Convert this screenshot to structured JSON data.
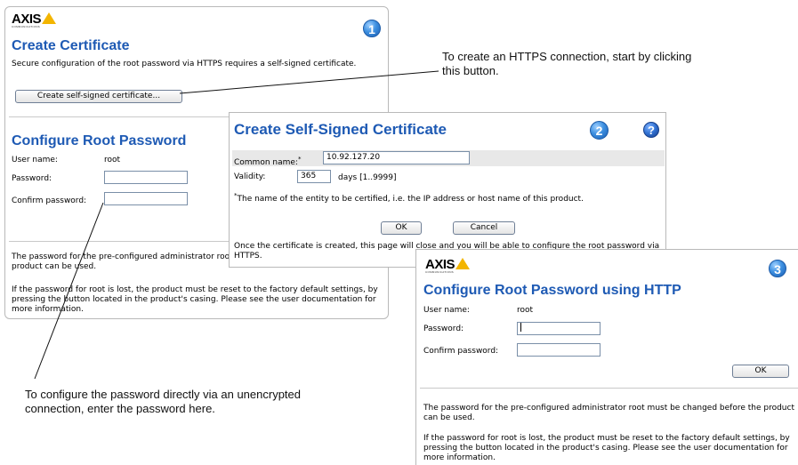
{
  "panel1": {
    "logo": "AXIS",
    "logo_sub": "COMMUNICATIONS",
    "badge": "1",
    "title": "Create Certificate",
    "description": "Secure configuration of the root password via HTTPS requires a self-signed certificate.",
    "create_button": "Create self-signed certificate...",
    "section_title": "Configure Root Password",
    "user_label": "User name:",
    "user_value": "root",
    "password_label": "Password:",
    "confirm_label": "Confirm password:",
    "note1": "The password for the pre-configured administrator root must be changed before the product can be used.",
    "note2": "If the password for root is lost, the product must be reset to the factory default settings, by pressing the button located in the product's casing. Please see the user documentation for more information."
  },
  "panel2": {
    "title": "Create Self-Signed Certificate",
    "badge": "2",
    "help": "?",
    "common_name_label": "Common name:",
    "required_mark": "*",
    "common_name_value": "10.92.127.20",
    "validity_label": "Validity:",
    "validity_value": "365",
    "validity_unit": "days [1..9999]",
    "footnote": "The name of the entity to be certified, i.e. the IP address or host name of this product.",
    "ok_button": "OK",
    "cancel_button": "Cancel",
    "bottom_text": "Once the certificate is created, this page will close and you will be able to configure the root password via HTTPS."
  },
  "panel3": {
    "logo": "AXIS",
    "logo_sub": "COMMUNICATIONS",
    "badge": "3",
    "title": "Configure Root Password using HTTP",
    "user_label": "User name:",
    "user_value": "root",
    "password_label": "Password:",
    "confirm_label": "Confirm password:",
    "ok_button": "OK",
    "note1": "The password for the pre-configured administrator root must be changed before the product can be used.",
    "note2": "If the password for root is lost, the product must be reset to the factory default settings, by pressing the button located in the product's casing. Please see the user documentation for more information."
  },
  "annotations": {
    "https_hint": "To create an HTTPS connection, start by clicking this button.",
    "direct_hint": "To configure the password directly via an unencrypted connection, enter the password here."
  },
  "colors": {
    "title_blue": "#1e5ab4",
    "logo_yellow": "#f3b500",
    "badge_blue": "#3d8fe0"
  }
}
